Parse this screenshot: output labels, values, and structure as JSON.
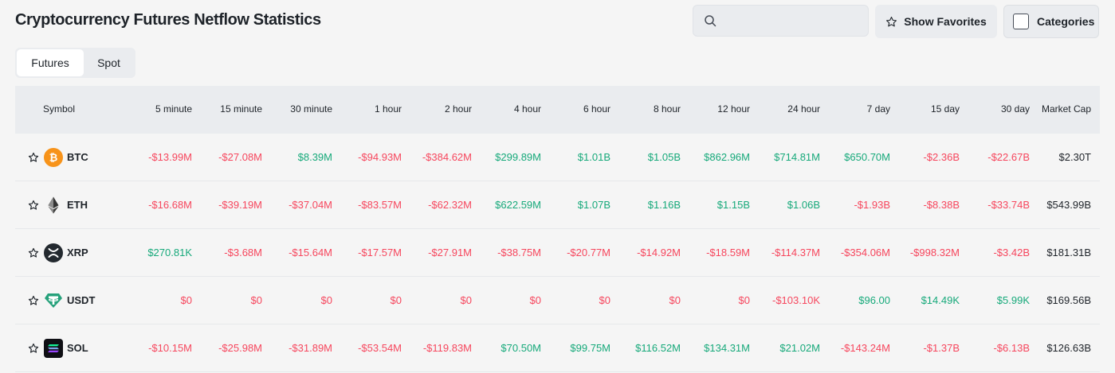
{
  "page": {
    "title": "Cryptocurrency Futures Netflow Statistics"
  },
  "toolbar": {
    "search_placeholder": "",
    "show_favorites_label": "Show Favorites",
    "categories_label": "Categories"
  },
  "tabs": [
    {
      "label": "Futures",
      "active": true
    },
    {
      "label": "Spot",
      "active": false
    }
  ],
  "columns": [
    "Symbol",
    "5 minute",
    "15 minute",
    "30 minute",
    "1 hour",
    "2 hour",
    "4 hour",
    "6 hour",
    "8 hour",
    "12 hour",
    "24 hour",
    "7 day",
    "15 day",
    "30 day",
    "Market Cap"
  ],
  "colors": {
    "negative": "#f6465d",
    "positive": "#16a97a",
    "btc": "#f7931a",
    "usdt": "#26a17b"
  },
  "rows": [
    {
      "symbol": "BTC",
      "icon": "btc-icon",
      "values": [
        "-$13.99M",
        "-$27.08M",
        "$8.39M",
        "-$94.93M",
        "-$384.62M",
        "$299.89M",
        "$1.01B",
        "$1.05B",
        "$862.96M",
        "$714.81M",
        "$650.70M",
        "-$2.36B",
        "-$22.67B"
      ],
      "market_cap": "$2.30T"
    },
    {
      "symbol": "ETH",
      "icon": "eth-icon",
      "values": [
        "-$16.68M",
        "-$39.19M",
        "-$37.04M",
        "-$83.57M",
        "-$62.32M",
        "$622.59M",
        "$1.07B",
        "$1.16B",
        "$1.15B",
        "$1.06B",
        "-$1.93B",
        "-$8.38B",
        "-$33.74B"
      ],
      "market_cap": "$543.99B"
    },
    {
      "symbol": "XRP",
      "icon": "xrp-icon",
      "values": [
        "$270.81K",
        "-$3.68M",
        "-$15.64M",
        "-$17.57M",
        "-$27.91M",
        "-$38.75M",
        "-$20.77M",
        "-$14.92M",
        "-$18.59M",
        "-$114.37M",
        "-$354.06M",
        "-$998.32M",
        "-$3.42B"
      ],
      "market_cap": "$181.31B"
    },
    {
      "symbol": "USDT",
      "icon": "usdt-icon",
      "values": [
        "$0",
        "$0",
        "$0",
        "$0",
        "$0",
        "$0",
        "$0",
        "$0",
        "$0",
        "-$103.10K",
        "$96.00",
        "$14.49K",
        "$5.99K"
      ],
      "market_cap": "$169.56B"
    },
    {
      "symbol": "SOL",
      "icon": "sol-icon",
      "values": [
        "-$10.15M",
        "-$25.98M",
        "-$31.89M",
        "-$53.54M",
        "-$119.83M",
        "$70.50M",
        "$99.75M",
        "$116.52M",
        "$134.31M",
        "$21.02M",
        "-$143.24M",
        "-$1.37B",
        "-$6.13B"
      ],
      "market_cap": "$126.63B"
    }
  ]
}
